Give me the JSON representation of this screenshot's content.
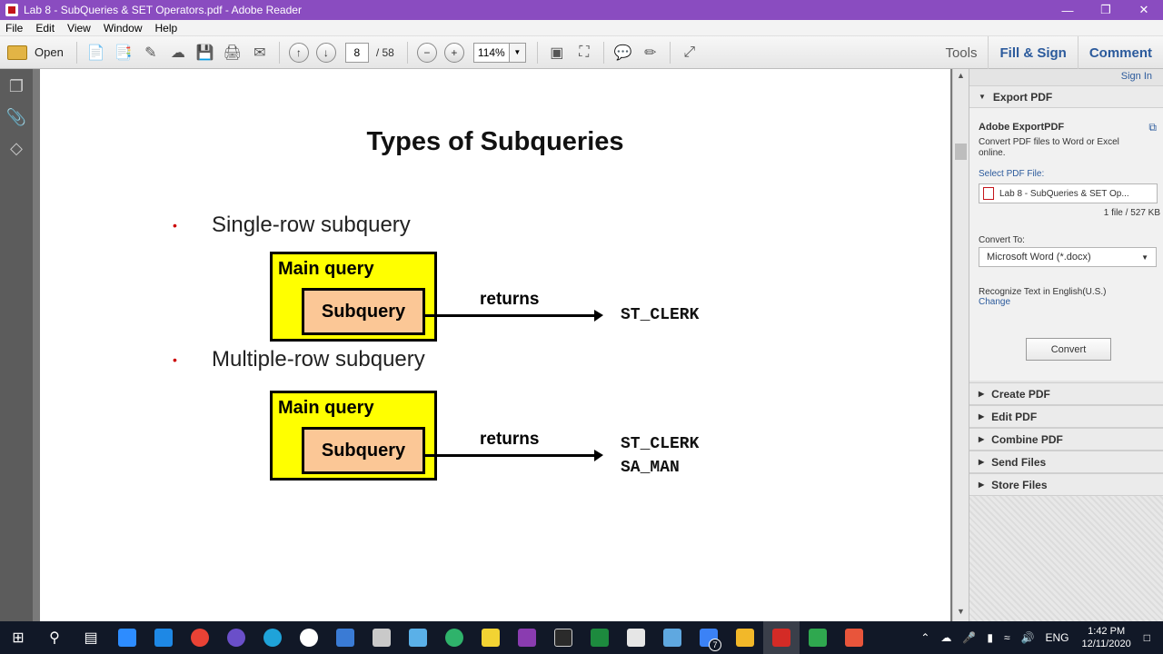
{
  "window": {
    "title": "Lab 8 - SubQueries & SET Operators.pdf - Adobe Reader",
    "controls": [
      "—",
      "❐",
      "✕"
    ]
  },
  "menu": [
    "File",
    "Edit",
    "View",
    "Window",
    "Help"
  ],
  "toolbar": {
    "open_label": "Open",
    "page_current": "8",
    "page_total": "/ 58",
    "zoom": "114%",
    "tabs": [
      "Tools",
      "Fill & Sign",
      "Comment"
    ]
  },
  "slide": {
    "title": "Types of Subqueries",
    "sections": [
      {
        "bullet": "•",
        "label": "Single-row subquery",
        "main_label": "Main query",
        "sub_label": "Subquery",
        "returns_label": "returns",
        "results": [
          "ST_CLERK"
        ]
      },
      {
        "bullet": "•",
        "label": "Multiple-row subquery",
        "main_label": "Main query",
        "sub_label": "Subquery",
        "returns_label": "returns",
        "results": [
          "ST_CLERK",
          "SA_MAN"
        ]
      }
    ]
  },
  "panel": {
    "sign_in": "Sign In",
    "export_header": "Export PDF",
    "adobe_export": "Adobe ExportPDF",
    "description": "Convert PDF files to Word or Excel online.",
    "select_label": "Select PDF File:",
    "file_name": "Lab 8 - SubQueries & SET Op...",
    "file_size": "1 file / 527 KB",
    "convert_to_label": "Convert To:",
    "convert_to_value": "Microsoft Word (*.docx)",
    "recognize": "Recognize Text in English(U.S.)",
    "change": "Change",
    "convert_button": "Convert",
    "sections": [
      "Create PDF",
      "Edit PDF",
      "Combine PDF",
      "Send Files",
      "Store Files"
    ]
  },
  "taskbar": {
    "lang": "ENG",
    "time": "1:42 PM",
    "date": "12/11/2020",
    "badge": "7"
  },
  "colors": {
    "titlebar": "#8a4cc0",
    "main_box": "#ffff00",
    "sub_box": "#fbc796",
    "link": "#2b5a9c",
    "bullet": "#cc0000"
  }
}
